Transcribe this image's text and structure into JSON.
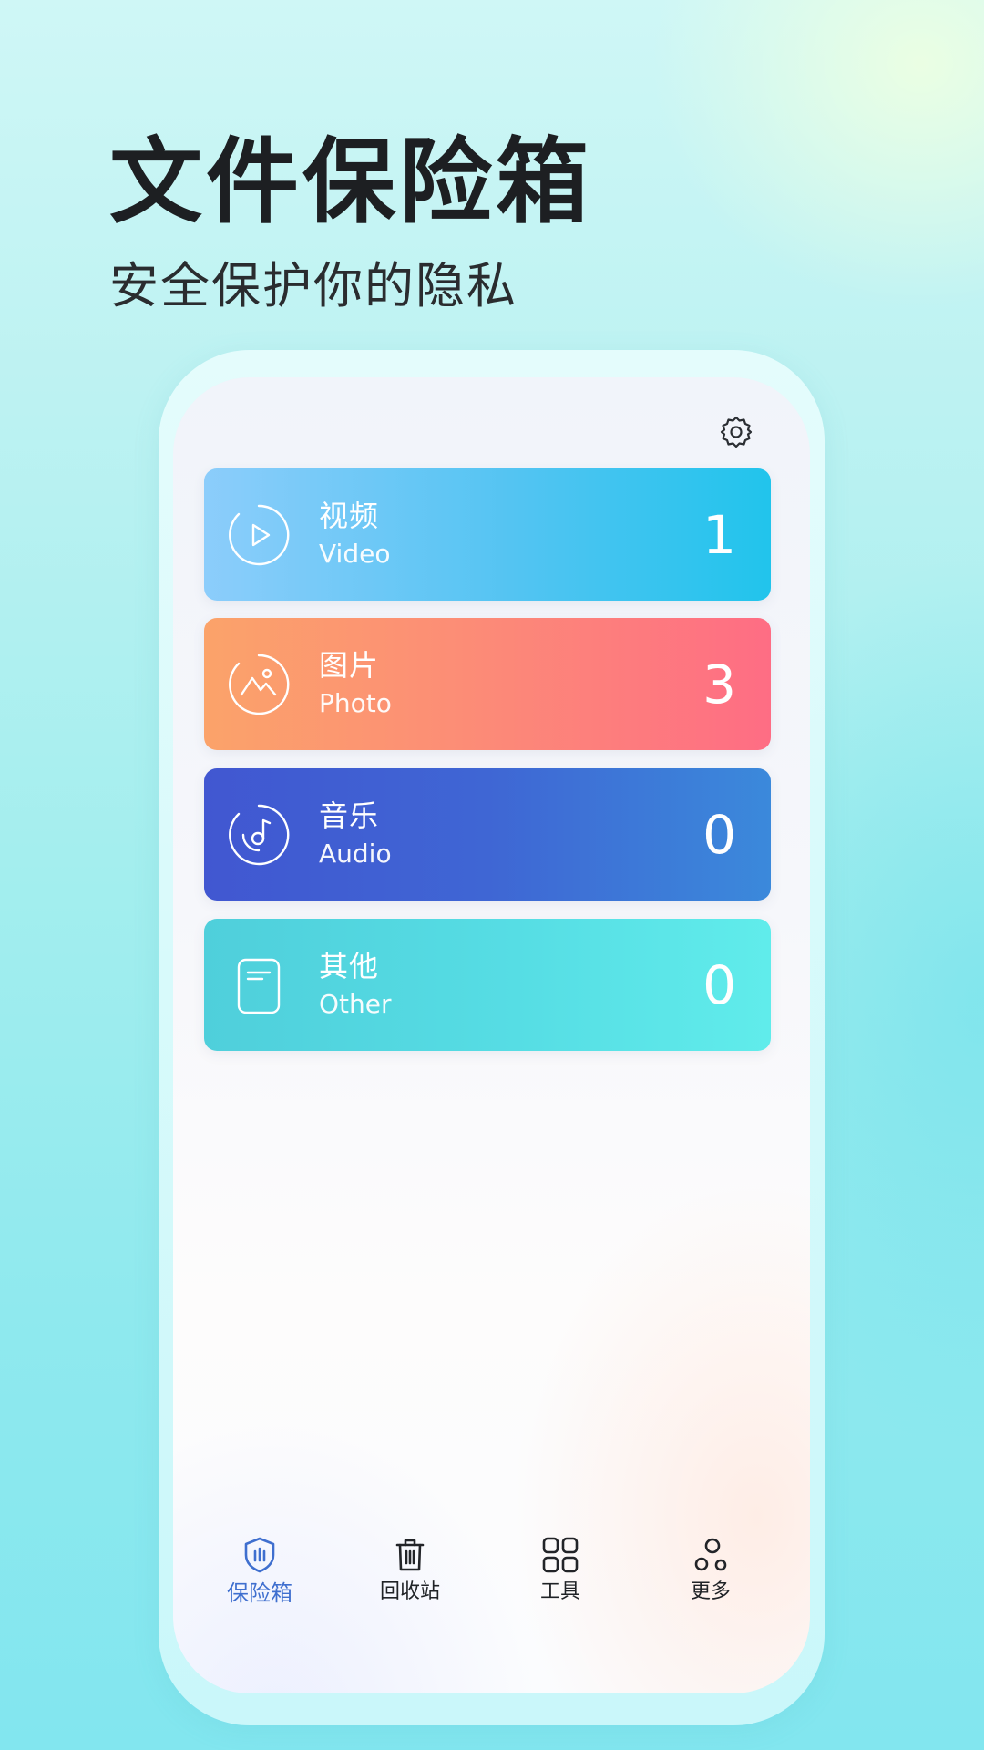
{
  "promo": {
    "title": "文件保险箱",
    "subtitle": "安全保护你的隐私"
  },
  "header": {
    "settings_icon": "gear-icon"
  },
  "categories": [
    {
      "title": "视频",
      "subtitle": "Video",
      "count": "1",
      "icon": "play-circle-icon"
    },
    {
      "title": "图片",
      "subtitle": "Photo",
      "count": "3",
      "icon": "image-circle-icon"
    },
    {
      "title": "音乐",
      "subtitle": "Audio",
      "count": "0",
      "icon": "music-disc-icon"
    },
    {
      "title": "其他",
      "subtitle": "Other",
      "count": "0",
      "icon": "document-icon"
    }
  ],
  "tabs": [
    {
      "label": "保险箱",
      "icon": "shield-vault-icon",
      "active": true
    },
    {
      "label": "回收站",
      "icon": "trash-icon",
      "active": false
    },
    {
      "label": "工具",
      "icon": "grid-apps-icon",
      "active": false
    },
    {
      "label": "更多",
      "icon": "more-circles-icon",
      "active": false
    }
  ],
  "colors": {
    "active_tab": "#3f6fcf",
    "video_card": "#21c4ec",
    "photo_card": "#fe6d84",
    "audio_card": "#3f66d4",
    "other_card": "#56dde4"
  }
}
